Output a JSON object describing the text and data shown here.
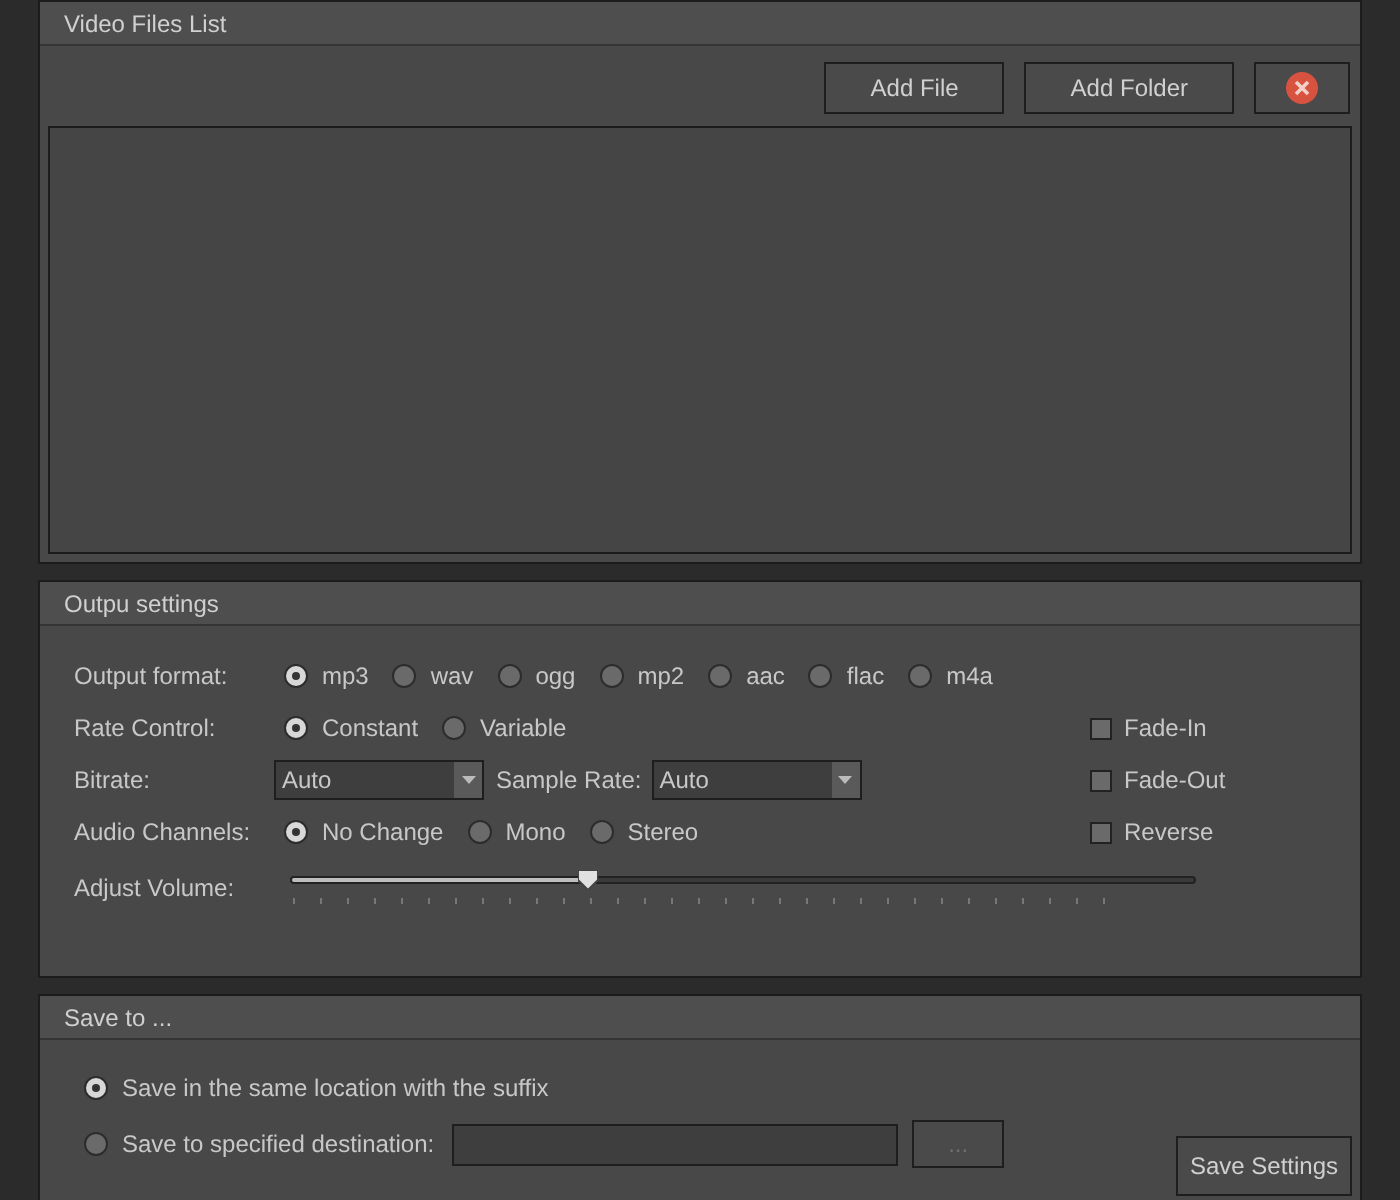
{
  "files_panel": {
    "title": "Video Files List",
    "buttons": [
      {
        "kind": "text",
        "label": "Add File"
      },
      {
        "kind": "text",
        "label": "Add Folder"
      },
      {
        "kind": "remove"
      }
    ]
  },
  "output_panel": {
    "title": "Outpu settings",
    "format": {
      "label": "Output format:",
      "options": [
        {
          "label": "mp3",
          "selected": true
        },
        {
          "label": "wav",
          "selected": false
        },
        {
          "label": "ogg",
          "selected": false
        },
        {
          "label": "mp2",
          "selected": false
        },
        {
          "label": "aac",
          "selected": false
        },
        {
          "label": "flac",
          "selected": false
        },
        {
          "label": "m4a",
          "selected": false
        }
      ]
    },
    "rate_control": {
      "label": "Rate Control:",
      "options": [
        {
          "label": "Constant",
          "selected": true
        },
        {
          "label": "Variable",
          "selected": false
        }
      ]
    },
    "bitrate": {
      "label": "Bitrate:",
      "value": "Auto"
    },
    "sample_rate": {
      "label": "Sample Rate:",
      "value": "Auto"
    },
    "channels": {
      "label": "Audio Channels:",
      "options": [
        {
          "label": "No Change",
          "selected": true
        },
        {
          "label": "Mono",
          "selected": false
        },
        {
          "label": "Stereo",
          "selected": false
        }
      ]
    },
    "volume": {
      "label": "Adjust Volume:",
      "level": 0.33
    },
    "effects": [
      {
        "label": "Fade-In",
        "checked": false
      },
      {
        "label": "Fade-Out",
        "checked": false
      },
      {
        "label": "Reverse",
        "checked": false
      }
    ]
  },
  "save_panel": {
    "title": "Save to ...",
    "options": [
      {
        "label": "Save in the same location with the suffix",
        "selected": true
      },
      {
        "label": "Save to specified destination:",
        "selected": false
      }
    ],
    "browse_button": {
      "label": "...",
      "disabled": true
    },
    "save_button": "Save Settings"
  }
}
